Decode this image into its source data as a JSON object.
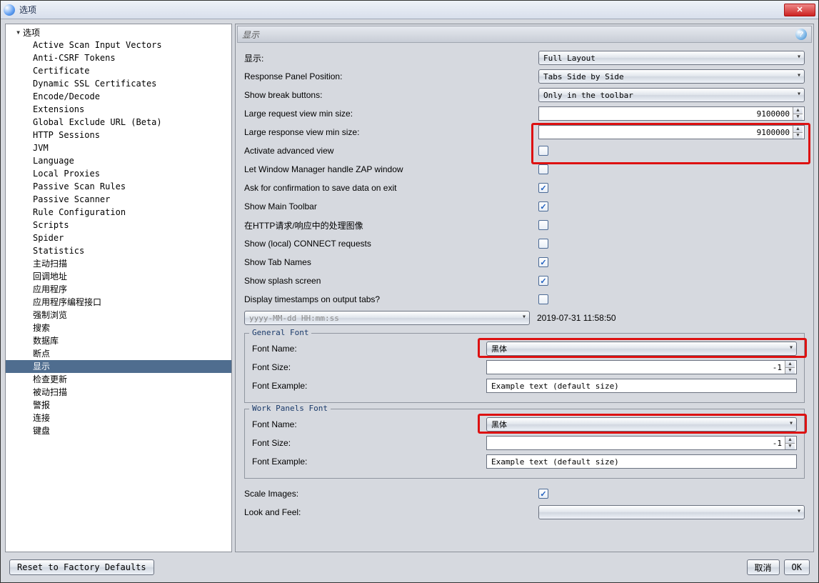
{
  "window": {
    "title": "选项"
  },
  "sidebar": {
    "root": "选项",
    "items": [
      "Active Scan Input Vectors",
      "Anti-CSRF Tokens",
      "Certificate",
      "Dynamic SSL Certificates",
      "Encode/Decode",
      "Extensions",
      "Global Exclude URL (Beta)",
      "HTTP Sessions",
      "JVM",
      "Language",
      "Local Proxies",
      "Passive Scan Rules",
      "Passive Scanner",
      "Rule Configuration",
      "Scripts",
      "Spider",
      "Statistics",
      "主动扫描",
      "回调地址",
      "应用程序",
      "应用程序编程接口",
      "强制浏览",
      "搜索",
      "数据库",
      "断点",
      "显示",
      "检查更新",
      "被动扫描",
      "警报",
      "连接",
      "键盘"
    ],
    "selected_index": 25
  },
  "panel": {
    "title": "显示"
  },
  "form": {
    "display_label": "显示:",
    "display_value": "Full Layout",
    "resp_panel_label": "Response Panel Position:",
    "resp_panel_value": "Tabs Side by Side",
    "break_btn_label": "Show break buttons:",
    "break_btn_value": "Only in the toolbar",
    "large_req_label": "Large request view min size:",
    "large_req_value": "9100000",
    "large_resp_label": "Large response view min size:",
    "large_resp_value": "9100000",
    "adv_view_label": "Activate advanced view",
    "wm_label": "Let Window Manager handle ZAP window",
    "ask_exit_label": "Ask for confirmation to save data on exit",
    "main_toolbar_label": "Show Main Toolbar",
    "http_img_label": "在HTTP请求/响应中的处理图像",
    "connect_label": "Show (local) CONNECT requests",
    "tab_names_label": "Show Tab Names",
    "splash_label": "Show splash screen",
    "ts_label": "Display timestamps on output tabs?",
    "ts_format": "yyyy-MM-dd HH:mm:ss",
    "ts_value": "2019-07-31 11:58:50",
    "scale_label": "Scale Images:",
    "laf_label": "Look and Feel:",
    "laf_value": "",
    "checks": {
      "adv": false,
      "wm": false,
      "ask": true,
      "toolbar": true,
      "img": false,
      "connect": false,
      "tabs": true,
      "splash": true,
      "ts": false,
      "scale": true
    }
  },
  "font_general": {
    "legend": "General Font",
    "name_label": "Font Name:",
    "name_value": "黑体",
    "size_label": "Font Size:",
    "size_value": "-1",
    "example_label": "Font Example:",
    "example_value": "Example text (default size)"
  },
  "font_work": {
    "legend": "Work Panels Font",
    "name_label": "Font Name:",
    "name_value": "黑体",
    "size_label": "Font Size:",
    "size_value": "-1",
    "example_label": "Font Example:",
    "example_value": "Example text (default size)"
  },
  "footer": {
    "reset": "Reset to Factory Defaults",
    "cancel": "取消",
    "ok": "OK"
  }
}
